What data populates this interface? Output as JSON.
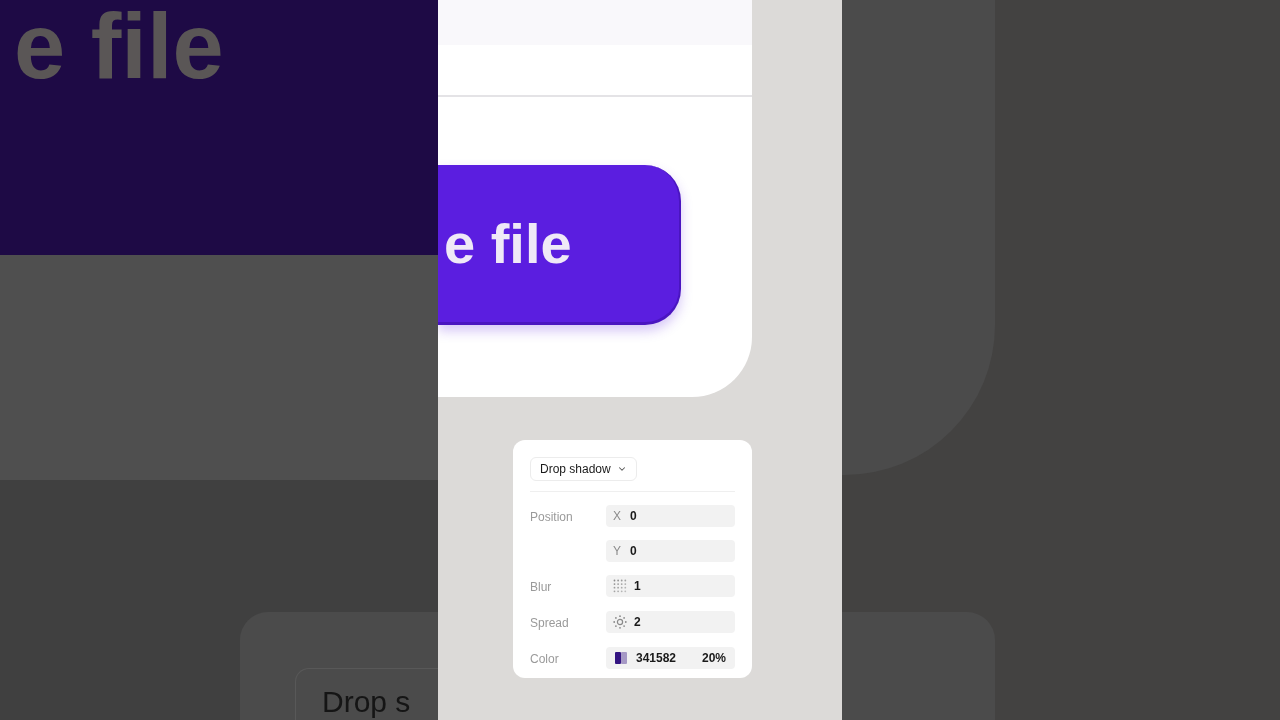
{
  "backdrop": {
    "headline": "e file",
    "panel_label": "Drop s"
  },
  "preview": {
    "button_label": "e file"
  },
  "effect_panel": {
    "effect": {
      "label": "Drop shadow"
    },
    "rows": [
      {
        "kind": "axis",
        "label": "Position",
        "axis": "X",
        "value": "0"
      },
      {
        "kind": "axis",
        "axis": "Y",
        "value": "0"
      },
      {
        "kind": "blur",
        "label": "Blur",
        "value": "1"
      },
      {
        "kind": "spread",
        "label": "Spread",
        "value": "2"
      },
      {
        "kind": "color",
        "label": "Color",
        "hex": "341582",
        "opacity": "20%"
      }
    ]
  }
}
